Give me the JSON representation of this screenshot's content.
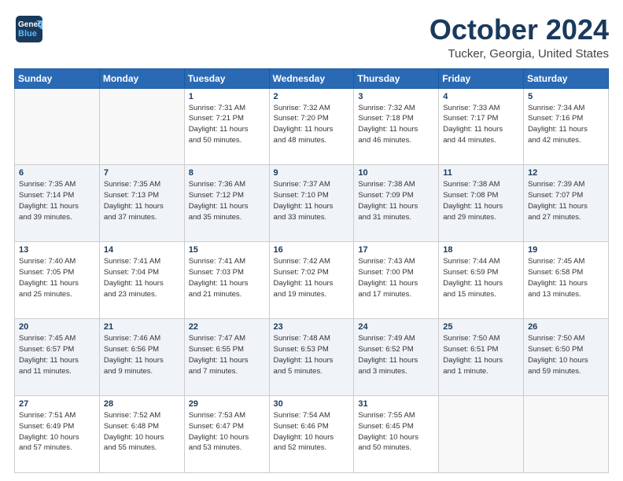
{
  "header": {
    "logo_general": "General",
    "logo_blue": "Blue",
    "month": "October 2024",
    "location": "Tucker, Georgia, United States"
  },
  "weekdays": [
    "Sunday",
    "Monday",
    "Tuesday",
    "Wednesday",
    "Thursday",
    "Friday",
    "Saturday"
  ],
  "weeks": [
    [
      {
        "day": "",
        "info": ""
      },
      {
        "day": "",
        "info": ""
      },
      {
        "day": "1",
        "info": "Sunrise: 7:31 AM\nSunset: 7:21 PM\nDaylight: 11 hours\nand 50 minutes."
      },
      {
        "day": "2",
        "info": "Sunrise: 7:32 AM\nSunset: 7:20 PM\nDaylight: 11 hours\nand 48 minutes."
      },
      {
        "day": "3",
        "info": "Sunrise: 7:32 AM\nSunset: 7:18 PM\nDaylight: 11 hours\nand 46 minutes."
      },
      {
        "day": "4",
        "info": "Sunrise: 7:33 AM\nSunset: 7:17 PM\nDaylight: 11 hours\nand 44 minutes."
      },
      {
        "day": "5",
        "info": "Sunrise: 7:34 AM\nSunset: 7:16 PM\nDaylight: 11 hours\nand 42 minutes."
      }
    ],
    [
      {
        "day": "6",
        "info": "Sunrise: 7:35 AM\nSunset: 7:14 PM\nDaylight: 11 hours\nand 39 minutes."
      },
      {
        "day": "7",
        "info": "Sunrise: 7:35 AM\nSunset: 7:13 PM\nDaylight: 11 hours\nand 37 minutes."
      },
      {
        "day": "8",
        "info": "Sunrise: 7:36 AM\nSunset: 7:12 PM\nDaylight: 11 hours\nand 35 minutes."
      },
      {
        "day": "9",
        "info": "Sunrise: 7:37 AM\nSunset: 7:10 PM\nDaylight: 11 hours\nand 33 minutes."
      },
      {
        "day": "10",
        "info": "Sunrise: 7:38 AM\nSunset: 7:09 PM\nDaylight: 11 hours\nand 31 minutes."
      },
      {
        "day": "11",
        "info": "Sunrise: 7:38 AM\nSunset: 7:08 PM\nDaylight: 11 hours\nand 29 minutes."
      },
      {
        "day": "12",
        "info": "Sunrise: 7:39 AM\nSunset: 7:07 PM\nDaylight: 11 hours\nand 27 minutes."
      }
    ],
    [
      {
        "day": "13",
        "info": "Sunrise: 7:40 AM\nSunset: 7:05 PM\nDaylight: 11 hours\nand 25 minutes."
      },
      {
        "day": "14",
        "info": "Sunrise: 7:41 AM\nSunset: 7:04 PM\nDaylight: 11 hours\nand 23 minutes."
      },
      {
        "day": "15",
        "info": "Sunrise: 7:41 AM\nSunset: 7:03 PM\nDaylight: 11 hours\nand 21 minutes."
      },
      {
        "day": "16",
        "info": "Sunrise: 7:42 AM\nSunset: 7:02 PM\nDaylight: 11 hours\nand 19 minutes."
      },
      {
        "day": "17",
        "info": "Sunrise: 7:43 AM\nSunset: 7:00 PM\nDaylight: 11 hours\nand 17 minutes."
      },
      {
        "day": "18",
        "info": "Sunrise: 7:44 AM\nSunset: 6:59 PM\nDaylight: 11 hours\nand 15 minutes."
      },
      {
        "day": "19",
        "info": "Sunrise: 7:45 AM\nSunset: 6:58 PM\nDaylight: 11 hours\nand 13 minutes."
      }
    ],
    [
      {
        "day": "20",
        "info": "Sunrise: 7:45 AM\nSunset: 6:57 PM\nDaylight: 11 hours\nand 11 minutes."
      },
      {
        "day": "21",
        "info": "Sunrise: 7:46 AM\nSunset: 6:56 PM\nDaylight: 11 hours\nand 9 minutes."
      },
      {
        "day": "22",
        "info": "Sunrise: 7:47 AM\nSunset: 6:55 PM\nDaylight: 11 hours\nand 7 minutes."
      },
      {
        "day": "23",
        "info": "Sunrise: 7:48 AM\nSunset: 6:53 PM\nDaylight: 11 hours\nand 5 minutes."
      },
      {
        "day": "24",
        "info": "Sunrise: 7:49 AM\nSunset: 6:52 PM\nDaylight: 11 hours\nand 3 minutes."
      },
      {
        "day": "25",
        "info": "Sunrise: 7:50 AM\nSunset: 6:51 PM\nDaylight: 11 hours\nand 1 minute."
      },
      {
        "day": "26",
        "info": "Sunrise: 7:50 AM\nSunset: 6:50 PM\nDaylight: 10 hours\nand 59 minutes."
      }
    ],
    [
      {
        "day": "27",
        "info": "Sunrise: 7:51 AM\nSunset: 6:49 PM\nDaylight: 10 hours\nand 57 minutes."
      },
      {
        "day": "28",
        "info": "Sunrise: 7:52 AM\nSunset: 6:48 PM\nDaylight: 10 hours\nand 55 minutes."
      },
      {
        "day": "29",
        "info": "Sunrise: 7:53 AM\nSunset: 6:47 PM\nDaylight: 10 hours\nand 53 minutes."
      },
      {
        "day": "30",
        "info": "Sunrise: 7:54 AM\nSunset: 6:46 PM\nDaylight: 10 hours\nand 52 minutes."
      },
      {
        "day": "31",
        "info": "Sunrise: 7:55 AM\nSunset: 6:45 PM\nDaylight: 10 hours\nand 50 minutes."
      },
      {
        "day": "",
        "info": ""
      },
      {
        "day": "",
        "info": ""
      }
    ]
  ]
}
